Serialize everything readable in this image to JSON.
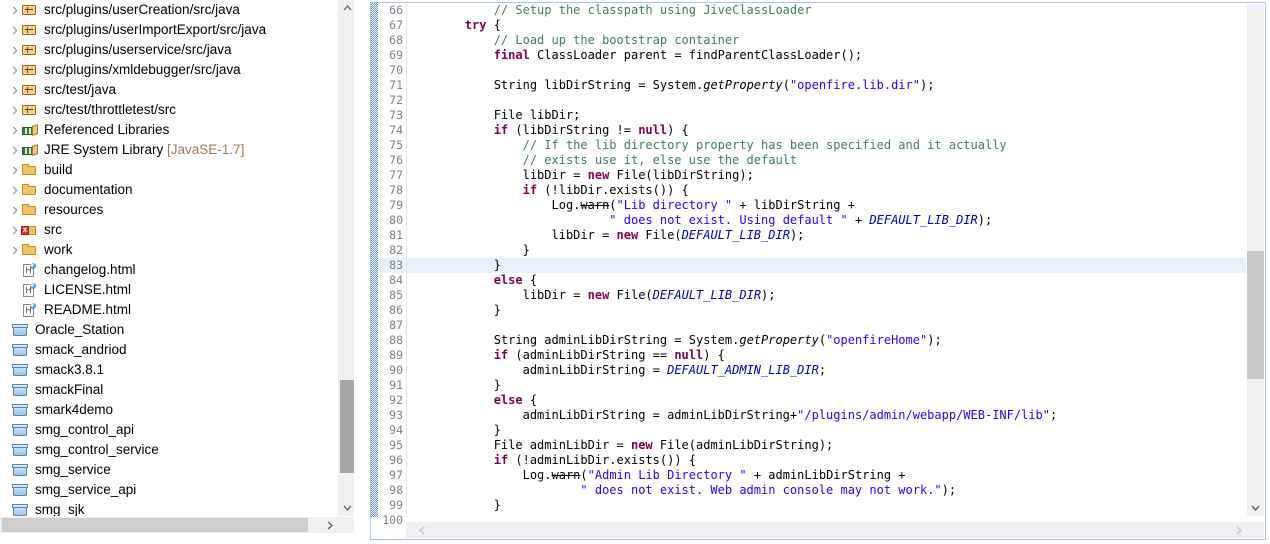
{
  "explorer": {
    "name": "package-explorer",
    "items": [
      {
        "label": "src/plugins/userCreation/src/java",
        "icon": "package-icon",
        "arrow": true,
        "indent": 1
      },
      {
        "label": "src/plugins/userImportExport/src/java",
        "icon": "package-icon",
        "arrow": true,
        "indent": 1
      },
      {
        "label": "src/plugins/userservice/src/java",
        "icon": "package-icon",
        "arrow": true,
        "indent": 1
      },
      {
        "label": "src/plugins/xmldebugger/src/java",
        "icon": "package-icon",
        "arrow": true,
        "indent": 1
      },
      {
        "label": "src/test/java",
        "icon": "package-icon",
        "arrow": true,
        "indent": 1
      },
      {
        "label": "src/test/throttletest/src",
        "icon": "package-icon",
        "arrow": true,
        "indent": 1
      },
      {
        "label": "Referenced Libraries",
        "icon": "library-icon",
        "arrow": true,
        "indent": 1
      },
      {
        "label": "JRE System Library",
        "suffix": "[JavaSE-1.7]",
        "icon": "library-icon",
        "arrow": true,
        "indent": 1
      },
      {
        "label": "build",
        "icon": "folder-icon",
        "arrow": true,
        "indent": 1
      },
      {
        "label": "documentation",
        "icon": "folder-icon",
        "arrow": true,
        "indent": 1
      },
      {
        "label": "resources",
        "icon": "folder-icon",
        "arrow": true,
        "indent": 1
      },
      {
        "label": "src",
        "icon": "folder-error-icon",
        "arrow": true,
        "indent": 1
      },
      {
        "label": "work",
        "icon": "folder-icon",
        "arrow": true,
        "indent": 1
      },
      {
        "label": "changelog.html",
        "icon": "html-file-icon",
        "arrow": false,
        "indent": 1
      },
      {
        "label": "LICENSE.html",
        "icon": "html-file-icon",
        "arrow": false,
        "indent": 1
      },
      {
        "label": "README.html",
        "icon": "html-file-icon",
        "arrow": false,
        "indent": 1
      },
      {
        "label": "Oracle_Station",
        "icon": "project-icon",
        "arrow": false,
        "indent": 0
      },
      {
        "label": "smack_andriod",
        "icon": "project-icon",
        "arrow": false,
        "indent": 0
      },
      {
        "label": "smack3.8.1",
        "icon": "project-icon",
        "arrow": false,
        "indent": 0
      },
      {
        "label": "smackFinal",
        "icon": "project-icon",
        "arrow": false,
        "indent": 0
      },
      {
        "label": "smark4demo",
        "icon": "project-icon",
        "arrow": false,
        "indent": 0
      },
      {
        "label": "smg_control_api",
        "icon": "project-icon",
        "arrow": false,
        "indent": 0
      },
      {
        "label": "smg_control_service",
        "icon": "project-icon",
        "arrow": false,
        "indent": 0
      },
      {
        "label": "smg_service",
        "icon": "project-icon",
        "arrow": false,
        "indent": 0
      },
      {
        "label": "smg_service_api",
        "icon": "project-icon",
        "arrow": false,
        "indent": 0
      },
      {
        "label": "smg_sjk",
        "icon": "project-icon",
        "arrow": false,
        "indent": 0
      }
    ],
    "scrollbar": {
      "vertical_up_glyph": "^",
      "vertical_down_glyph": "v",
      "horizontal_right_glyph": ">"
    }
  },
  "editor": {
    "name": "java-source-editor",
    "first_line": 66,
    "highlighted_line": 83,
    "colors": {
      "comment": "#3f7f5f",
      "keyword": "#7f0055",
      "string": "#2a00ff",
      "field": "#0000c0",
      "line_number": "#808080",
      "current_line_background": "#e8f2fe",
      "change_bar": "#5f92c8"
    },
    "scrollbar": {
      "down_glyph": "v",
      "h_left_glyph": "<",
      "h_right_glyph": ">"
    },
    "lines": [
      {
        "n": 66,
        "segments": [
          {
            "t": "            // Setup the classpath using JiveClassLoader",
            "c": "cmt"
          }
        ]
      },
      {
        "n": 67,
        "segments": [
          {
            "t": "        "
          },
          {
            "t": "try",
            "c": "kw"
          },
          {
            "t": " {"
          }
        ]
      },
      {
        "n": 68,
        "segments": [
          {
            "t": "            "
          },
          {
            "t": "// Load up the bootstrap container",
            "c": "cmt"
          }
        ]
      },
      {
        "n": 69,
        "segments": [
          {
            "t": "            "
          },
          {
            "t": "final",
            "c": "kw"
          },
          {
            "t": " ClassLoader parent = findParentClassLoader();"
          }
        ]
      },
      {
        "n": 70,
        "segments": [
          {
            "t": ""
          }
        ]
      },
      {
        "n": 71,
        "segments": [
          {
            "t": "            String libDirString = System."
          },
          {
            "t": "getProperty",
            "c": "mth"
          },
          {
            "t": "("
          },
          {
            "t": "\"openfire.lib.dir\"",
            "c": "str"
          },
          {
            "t": ");"
          }
        ]
      },
      {
        "n": 72,
        "segments": [
          {
            "t": ""
          }
        ]
      },
      {
        "n": 73,
        "segments": [
          {
            "t": "            File libDir;"
          }
        ]
      },
      {
        "n": 74,
        "segments": [
          {
            "t": "            "
          },
          {
            "t": "if",
            "c": "kw"
          },
          {
            "t": " (libDirString != "
          },
          {
            "t": "null",
            "c": "kw"
          },
          {
            "t": ") {"
          }
        ]
      },
      {
        "n": 75,
        "segments": [
          {
            "t": "                "
          },
          {
            "t": "// If the lib directory property has been specified and it actually",
            "c": "cmt"
          }
        ]
      },
      {
        "n": 76,
        "segments": [
          {
            "t": "                "
          },
          {
            "t": "// exists use it, else use the default",
            "c": "cmt"
          }
        ]
      },
      {
        "n": 77,
        "segments": [
          {
            "t": "                libDir = "
          },
          {
            "t": "new",
            "c": "kw"
          },
          {
            "t": " File(libDirString);"
          }
        ]
      },
      {
        "n": 78,
        "segments": [
          {
            "t": "                "
          },
          {
            "t": "if",
            "c": "kw"
          },
          {
            "t": " (!libDir.exists()) {"
          }
        ]
      },
      {
        "n": 79,
        "segments": [
          {
            "t": "                    Log."
          },
          {
            "t": "warn",
            "c": "dep"
          },
          {
            "t": "("
          },
          {
            "t": "\"Lib directory \"",
            "c": "str"
          },
          {
            "t": " + libDirString +"
          }
        ]
      },
      {
        "n": 80,
        "segments": [
          {
            "t": "                            "
          },
          {
            "t": "\" does not exist. Using default \"",
            "c": "str"
          },
          {
            "t": " + "
          },
          {
            "t": "DEFAULT_LIB_DIR",
            "c": "fld"
          },
          {
            "t": ");"
          }
        ]
      },
      {
        "n": 81,
        "segments": [
          {
            "t": "                    libDir = "
          },
          {
            "t": "new",
            "c": "kw"
          },
          {
            "t": " File("
          },
          {
            "t": "DEFAULT_LIB_DIR",
            "c": "fld"
          },
          {
            "t": ");"
          }
        ]
      },
      {
        "n": 82,
        "segments": [
          {
            "t": "                }"
          }
        ]
      },
      {
        "n": 83,
        "segments": [
          {
            "t": "            }"
          }
        ],
        "hl": true
      },
      {
        "n": 84,
        "segments": [
          {
            "t": "            "
          },
          {
            "t": "else",
            "c": "kw"
          },
          {
            "t": " {"
          }
        ]
      },
      {
        "n": 85,
        "segments": [
          {
            "t": "                libDir = "
          },
          {
            "t": "new",
            "c": "kw"
          },
          {
            "t": " File("
          },
          {
            "t": "DEFAULT_LIB_DIR",
            "c": "fld"
          },
          {
            "t": ");"
          }
        ]
      },
      {
        "n": 86,
        "segments": [
          {
            "t": "            }"
          }
        ]
      },
      {
        "n": 87,
        "segments": [
          {
            "t": ""
          }
        ]
      },
      {
        "n": 88,
        "segments": [
          {
            "t": "            String adminLibDirString = System."
          },
          {
            "t": "getProperty",
            "c": "mth"
          },
          {
            "t": "("
          },
          {
            "t": "\"openfireHome\"",
            "c": "str"
          },
          {
            "t": ");"
          }
        ]
      },
      {
        "n": 89,
        "segments": [
          {
            "t": "            "
          },
          {
            "t": "if",
            "c": "kw"
          },
          {
            "t": " (adminLibDirString == "
          },
          {
            "t": "null",
            "c": "kw"
          },
          {
            "t": ") {"
          }
        ]
      },
      {
        "n": 90,
        "segments": [
          {
            "t": "                adminLibDirString = "
          },
          {
            "t": "DEFAULT_ADMIN_LIB_DIR",
            "c": "fld"
          },
          {
            "t": ";"
          }
        ]
      },
      {
        "n": 91,
        "segments": [
          {
            "t": "            }"
          }
        ]
      },
      {
        "n": 92,
        "segments": [
          {
            "t": "            "
          },
          {
            "t": "else",
            "c": "kw"
          },
          {
            "t": " {"
          }
        ]
      },
      {
        "n": 93,
        "segments": [
          {
            "t": "                adminLibDirString = adminLibDirString+"
          },
          {
            "t": "\"/plugins/admin/webapp/WEB-INF/lib\"",
            "c": "str"
          },
          {
            "t": ";"
          }
        ]
      },
      {
        "n": 94,
        "segments": [
          {
            "t": "            }"
          }
        ]
      },
      {
        "n": 95,
        "segments": [
          {
            "t": "            File adminLibDir = "
          },
          {
            "t": "new",
            "c": "kw"
          },
          {
            "t": " File(adminLibDirString);"
          }
        ]
      },
      {
        "n": 96,
        "segments": [
          {
            "t": "            "
          },
          {
            "t": "if",
            "c": "kw"
          },
          {
            "t": " (!adminLibDir.exists()) {"
          }
        ]
      },
      {
        "n": 97,
        "segments": [
          {
            "t": "                Log."
          },
          {
            "t": "warn",
            "c": "dep"
          },
          {
            "t": "("
          },
          {
            "t": "\"Admin Lib Directory \"",
            "c": "str"
          },
          {
            "t": " + adminLibDirString +"
          }
        ]
      },
      {
        "n": 98,
        "segments": [
          {
            "t": "                        "
          },
          {
            "t": "\" does not exist. Web admin console may not work.\"",
            "c": "str"
          },
          {
            "t": ");"
          }
        ]
      },
      {
        "n": 99,
        "segments": [
          {
            "t": "            }"
          }
        ]
      },
      {
        "n": 100,
        "segments": [
          {
            "t": ""
          }
        ]
      }
    ]
  }
}
